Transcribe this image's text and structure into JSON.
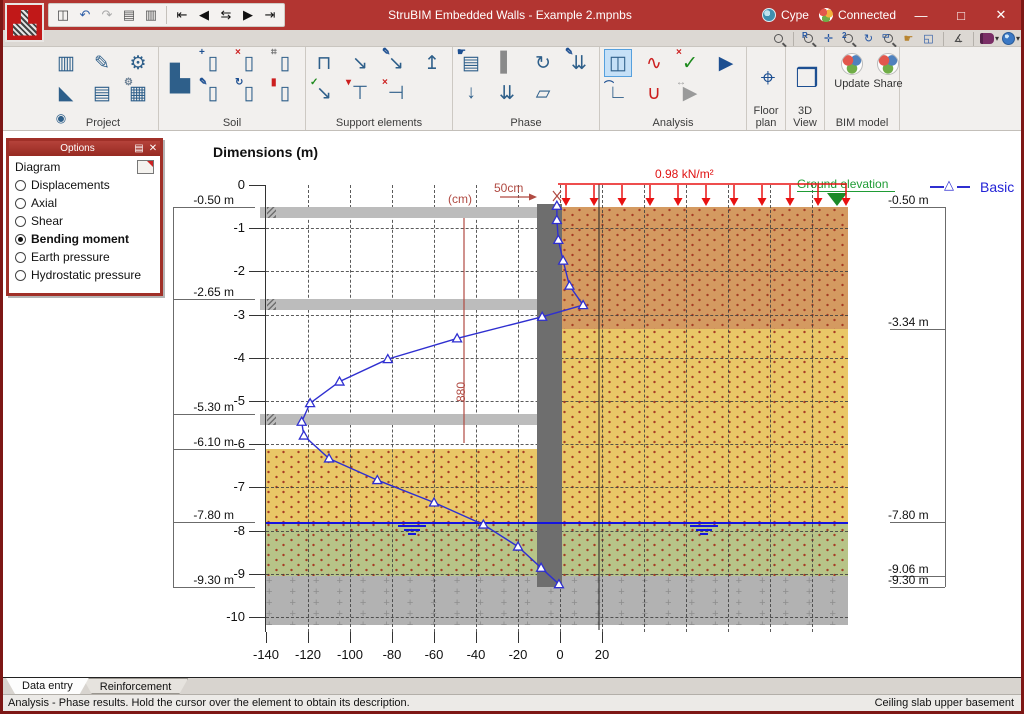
{
  "window": {
    "title": "StruBIM Embedded Walls - Example 2.mpnbs",
    "account": "Cype",
    "connection": "Connected",
    "minimize": "—",
    "maximize": "□",
    "close": "✕"
  },
  "quickbar": [
    {
      "name": "save-button",
      "g": "◫",
      "c": "#444"
    },
    {
      "name": "undo-button",
      "g": "↶",
      "c": "#2f5fa8"
    },
    {
      "name": "redo-button",
      "g": "↷",
      "c": "#a9a9a9"
    },
    {
      "name": "print-button",
      "g": "▤",
      "c": "#555"
    },
    {
      "name": "print-config-button",
      "g": "▥",
      "c": "#555"
    },
    {
      "name": "sep",
      "sep": true
    },
    {
      "name": "go-first-button",
      "g": "⇤",
      "c": "#111"
    },
    {
      "name": "go-previous-button",
      "g": "◀",
      "c": "#111"
    },
    {
      "name": "go-phase-button",
      "g": "⇆",
      "c": "#111"
    },
    {
      "name": "go-next-button",
      "g": "▶",
      "c": "#111"
    },
    {
      "name": "go-last-button",
      "g": "⇥",
      "c": "#111"
    }
  ],
  "viewtools": [
    {
      "name": "search-tool",
      "kind": "mag",
      "badge": ""
    },
    {
      "name": "sep",
      "sep": true
    },
    {
      "name": "zoom-previous-tool",
      "kind": "mag",
      "badge": "R"
    },
    {
      "name": "zoom-extents-tool",
      "kind": "glyph",
      "g": "✛",
      "c": "#2456a4"
    },
    {
      "name": "zoom-scale-tool",
      "kind": "mag",
      "badge": "2"
    },
    {
      "name": "redraw-tool",
      "kind": "glyph",
      "g": "↻",
      "c": "#2456a4"
    },
    {
      "name": "zoom-window-tool",
      "kind": "mag",
      "badge": "▭"
    },
    {
      "name": "pan-tool",
      "kind": "glyph",
      "g": "☛",
      "c": "#b88430"
    },
    {
      "name": "send-view-tool",
      "kind": "glyph",
      "g": "◱",
      "c": "#2456a4"
    },
    {
      "name": "sep",
      "sep": true
    },
    {
      "name": "measure-tool",
      "kind": "glyph",
      "g": "∡",
      "c": "#444"
    },
    {
      "name": "sep",
      "sep": true
    },
    {
      "name": "help-book-menu",
      "kind": "book"
    },
    {
      "name": "web-menu",
      "kind": "globe"
    }
  ],
  "ribbon": {
    "groups": [
      {
        "label": "Project",
        "cols": 3,
        "items": [
          {
            "name": "project-walls-icon",
            "g": "▥"
          },
          {
            "name": "edit-project-icon",
            "g": "✎"
          },
          {
            "name": "general-settings-icon",
            "g": "⚙"
          },
          {
            "name": "soil-fill-icon",
            "g": "◣"
          },
          {
            "name": "wall-data-icon",
            "g": "▤"
          },
          {
            "name": "report-tables-icon",
            "g": "▦",
            "b": "⚙",
            "bc": "#6b7f93"
          },
          {
            "name": "view-options-icon",
            "g": "◉",
            "small": true
          }
        ]
      },
      {
        "label": "Soil",
        "cols": 4,
        "items": [
          {
            "name": "soil-profile-icon",
            "g": "▙",
            "big": true
          },
          {
            "name": "add-soil-layer-icon",
            "g": "▯",
            "b": "+",
            "bc": "#1d4f91"
          },
          {
            "name": "delete-soil-layer-icon",
            "g": "▯",
            "b": "×",
            "bc": "#cc1f1f"
          },
          {
            "name": "soil-layer-template-icon",
            "g": "▯",
            "b": "⌗",
            "bc": "#777777"
          },
          {
            "name": "edit-soil-layer-icon",
            "g": "▯",
            "b": "✎",
            "bc": "#1d4f91"
          },
          {
            "name": "rotate-soil-icon",
            "g": "▯",
            "b": "↻",
            "bc": "#1d4f91"
          },
          {
            "name": "soil-colors-icon",
            "g": "▯",
            "b": "▮",
            "bc": "#cc1f1f"
          }
        ]
      },
      {
        "label": "Support elements",
        "cols": 4,
        "items": [
          {
            "name": "add-strut-icon",
            "g": "⊓"
          },
          {
            "name": "add-anchor-icon",
            "g": "↘"
          },
          {
            "name": "edit-anchor-icon",
            "g": "↘",
            "b": "✎",
            "bc": "#1d4f91"
          },
          {
            "name": "raise-support-icon",
            "g": "↥"
          },
          {
            "name": "anchor-check-icon",
            "g": "↘",
            "b": "✓",
            "bc": "#1d8a1d"
          },
          {
            "name": "strut-level-icon",
            "g": "⊤",
            "b": "▾",
            "bc": "#cc1f1f"
          },
          {
            "name": "delete-support-icon",
            "g": "⊣",
            "b": "×",
            "bc": "#cc1f1f"
          }
        ]
      },
      {
        "label": "Phase",
        "cols": 4,
        "items": [
          {
            "name": "phase-data-icon",
            "g": "▤",
            "b": "☛",
            "bc": "#1d4f91"
          },
          {
            "name": "excavation-step-icon",
            "g": "▌",
            "c": "#8a8a8a"
          },
          {
            "name": "rotate-phase-icon",
            "g": "↻"
          },
          {
            "name": "edit-loads-icon",
            "g": "⇊",
            "b": "✎",
            "bc": "#1d4f91"
          },
          {
            "name": "lower-level-icon",
            "g": "↓"
          },
          {
            "name": "phase-loads-icon",
            "g": "⇊"
          },
          {
            "name": "erase-phase-icon",
            "g": "▱"
          }
        ]
      },
      {
        "label": "Analysis",
        "cols": 4,
        "items": [
          {
            "name": "diagrams-icon",
            "g": "◫",
            "selected": true
          },
          {
            "name": "envelope-curve-icon",
            "g": "∿",
            "c": "#cc1f1f"
          },
          {
            "name": "code-check-icon",
            "g": "✓",
            "c": "#1d8a1d",
            "b": "×",
            "bc": "#cc1f1f"
          },
          {
            "name": "calculate-icon",
            "g": "▶",
            "c": "#1d4f91"
          },
          {
            "name": "results-graph-icon",
            "g": "∟",
            "b": "⌒",
            "bc": "#1d4f91"
          },
          {
            "name": "section-envelope-icon",
            "g": "∪",
            "c": "#cc1f1f"
          },
          {
            "name": "partial-analysis-icon",
            "g": "▶",
            "c": "#9a9a9a",
            "b": "↔",
            "bc": "#9a9a9a"
          }
        ]
      },
      {
        "label": "Floor plan",
        "cols": 1,
        "items": [
          {
            "name": "floor-plan-icon",
            "g": "⌖",
            "big": true,
            "c": "#1d4f91"
          }
        ]
      },
      {
        "label": "3D View",
        "cols": 1,
        "items": [
          {
            "name": "view-3d-icon",
            "g": "❒",
            "big": true,
            "c": "#1d4f91"
          }
        ]
      },
      {
        "label": "BIM model",
        "cols": 2,
        "items": [
          {
            "name": "bim-update-icon",
            "logo": true,
            "caption": "Update"
          },
          {
            "name": "bim-share-icon",
            "logo": true,
            "caption": "Share"
          }
        ]
      }
    ]
  },
  "options_panel": {
    "title": "Options",
    "book_icon": "▤",
    "close_icon": "✕",
    "group_label": "Diagram",
    "items": [
      {
        "label": "Displacements",
        "selected": false
      },
      {
        "label": "Axial",
        "selected": false
      },
      {
        "label": "Shear",
        "selected": false
      },
      {
        "label": "Bending moment",
        "selected": true
      },
      {
        "label": "Earth pressure",
        "selected": false
      },
      {
        "label": "Hydrostatic pressure",
        "selected": false
      }
    ]
  },
  "chart_data": {
    "type": "line",
    "title": "Dimensions (m)",
    "x_ticks": [
      -140,
      -120,
      -100,
      -80,
      -60,
      -40,
      -20,
      0,
      20
    ],
    "y_ticks": [
      0,
      -1,
      -2,
      -3,
      -4,
      -5,
      -6,
      -7,
      -8,
      -9,
      -10
    ],
    "legend_position": "top-right",
    "series": [
      {
        "name": "Basic",
        "color": "#2f2fd0",
        "marker": "triangle-open",
        "points_moment_depth": [
          [
            -1.5,
            -0.48
          ],
          [
            -1.5,
            -0.81
          ],
          [
            -0.8,
            -1.27
          ],
          [
            1.5,
            -1.75
          ],
          [
            4.5,
            -2.33
          ],
          [
            11,
            -2.78
          ],
          [
            -8.5,
            -3.05
          ],
          [
            -49,
            -3.55
          ],
          [
            -82,
            -4.03
          ],
          [
            -105,
            -4.55
          ],
          [
            -119,
            -5.05
          ],
          [
            -123,
            -5.48
          ],
          [
            -122,
            -5.8
          ],
          [
            -110,
            -6.33
          ],
          [
            -87,
            -6.83
          ],
          [
            -60,
            -7.35
          ],
          [
            -36.5,
            -7.86
          ],
          [
            -20,
            -8.37
          ],
          [
            -9,
            -8.86
          ],
          [
            -0.5,
            -9.24
          ]
        ]
      }
    ],
    "left_levels": [
      {
        "label": "-0.50 m",
        "depth": 0.5
      },
      {
        "label": "-2.65 m",
        "depth": 2.65
      },
      {
        "label": "-5.30 m",
        "depth": 5.3
      },
      {
        "label": "-6.10 m",
        "depth": 6.1
      },
      {
        "label": "-7.80 m",
        "depth": 7.8
      },
      {
        "label": "-9.30 m",
        "depth": 9.3
      }
    ],
    "right_levels": [
      {
        "label": "-0.50 m",
        "depth": 0.5
      },
      {
        "label": "-3.34 m",
        "depth": 3.34
      },
      {
        "label": "-7.80 m",
        "depth": 7.8
      },
      {
        "label": "-9.06 m",
        "depth": 9.06
      },
      {
        "label": "-9.30 m",
        "depth": 9.3
      }
    ],
    "surcharge_label": "0.98 kN/m²",
    "ground_elevation_label": "Ground elevation",
    "ground_elevation_depth": 0.5,
    "water_table_depth": 7.8,
    "annotations": {
      "wall_width": "50cm",
      "unit_note": "(cm)",
      "wall_height": "880"
    },
    "soil_layers_right": [
      {
        "from": 0.5,
        "to": 3.34,
        "color": "#d49a61",
        "pattern": "dots"
      },
      {
        "from": 3.34,
        "to": 7.8,
        "color": "#e9c767",
        "pattern": "dots"
      },
      {
        "from": 7.8,
        "to": 9.06,
        "color": "#b7c488",
        "pattern": "dots"
      }
    ],
    "soil_layers_left": [
      {
        "from": 6.1,
        "to": 7.8,
        "color": "#e9c767",
        "pattern": "dots"
      },
      {
        "from": 7.8,
        "to": 9.06,
        "color": "#b7c488",
        "pattern": "dots"
      }
    ],
    "rock_layer": {
      "from": 9.06,
      "to": 10.18,
      "color": "#b2b2b2",
      "pattern": "plus"
    },
    "slabs_depths": [
      0.5,
      2.64,
      5.3
    ],
    "wall": {
      "bottom_depth": 9.3
    }
  },
  "legend": {
    "series_label": "Basic"
  },
  "tabs": {
    "items": [
      "Data entry",
      "Reinforcement"
    ],
    "active": 0
  },
  "statusbar": {
    "left": "Analysis - Phase results. Hold the cursor over the element to obtain its description.",
    "right": "Ceiling slab upper basement"
  }
}
